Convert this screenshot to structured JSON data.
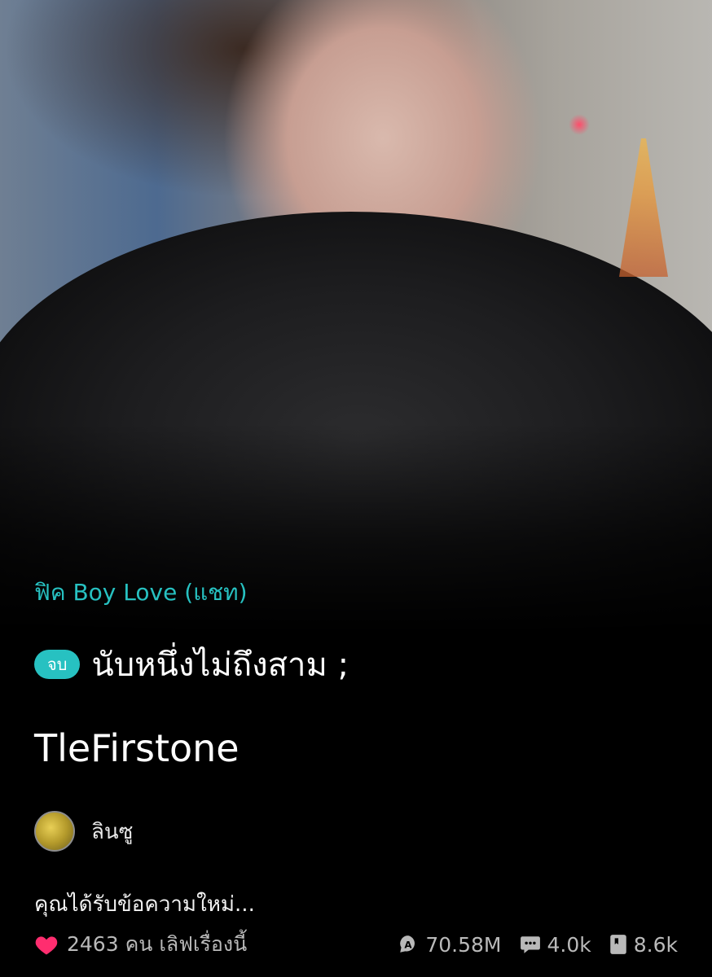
{
  "category": "ฟิค Boy Love (แชท)",
  "status_badge": "จบ",
  "title_line1": "นับหนึ่งไม่ถึงสาม ;",
  "title_line2": "TleFirstone",
  "author": {
    "name": "ลินซู"
  },
  "description": "คุณได้รับข้อความใหม่...",
  "stats": {
    "likes": "2463 คน เลิฟเรื่องนี้",
    "views": "70.58M",
    "comments": "4.0k",
    "bookmarks": "8.6k"
  },
  "colors": {
    "accent": "#27c1c1",
    "heart": "#ff2d6f",
    "background": "#000000"
  },
  "icons": [
    "heart-icon",
    "views-icon",
    "comment-icon",
    "bookmark-icon"
  ]
}
